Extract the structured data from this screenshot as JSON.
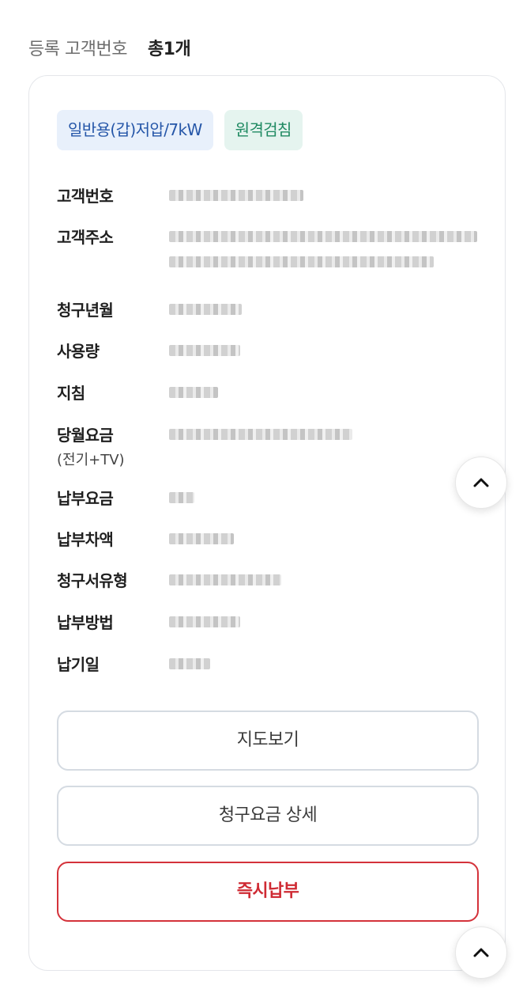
{
  "summary": {
    "label": "등록 고객번호",
    "count": "총1개"
  },
  "card": {
    "badges": [
      {
        "label": "일반용(갑)저압/7kW",
        "tone": "blue"
      },
      {
        "label": "원격검침",
        "tone": "green"
      }
    ],
    "fields": [
      {
        "key": "고객번호",
        "subkey": ""
      },
      {
        "key": "고객주소",
        "subkey": ""
      },
      {
        "key": "청구년월",
        "subkey": ""
      },
      {
        "key": "사용량",
        "subkey": ""
      },
      {
        "key": "지침",
        "subkey": ""
      },
      {
        "key": "당월요금",
        "subkey": "(전기+TV)"
      },
      {
        "key": "납부요금",
        "subkey": ""
      },
      {
        "key": "납부차액",
        "subkey": ""
      },
      {
        "key": "청구서유형",
        "subkey": ""
      },
      {
        "key": "납부방법",
        "subkey": ""
      },
      {
        "key": "납기일",
        "subkey": ""
      }
    ],
    "buttons": {
      "map": "지도보기",
      "detail": "청구요금 상세",
      "pay": "즉시납부"
    }
  },
  "icons": {
    "scroll_top": "chevron-up-icon"
  },
  "colors": {
    "badge_blue_bg": "#e8f0fb",
    "badge_blue_text": "#2556a8",
    "badge_green_bg": "#e5f4ef",
    "badge_green_text": "#1f8a62",
    "pay_button": "#d4323a"
  }
}
